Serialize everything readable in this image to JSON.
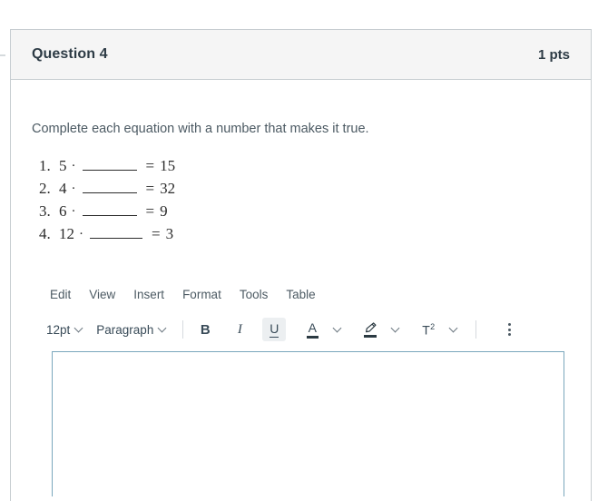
{
  "question": {
    "title": "Question 4",
    "points": "1 pts",
    "prompt": "Complete each equation with a number that makes it true.",
    "equations": [
      {
        "index": "1.",
        "left": "5",
        "operator": "·",
        "blank": "______",
        "equals": "=",
        "right": "15"
      },
      {
        "index": "2.",
        "left": "4",
        "operator": "·",
        "blank": "______",
        "equals": "=",
        "right": "32"
      },
      {
        "index": "3.",
        "left": "6",
        "operator": "·",
        "blank": "______",
        "equals": "=",
        "right": "9"
      },
      {
        "index": "4.",
        "left": "12",
        "operator": "·",
        "blank": "______",
        "equals": "=",
        "right": "3"
      }
    ]
  },
  "editor": {
    "menu": [
      {
        "label": "Edit"
      },
      {
        "label": "View"
      },
      {
        "label": "Insert"
      },
      {
        "label": "Format"
      },
      {
        "label": "Tools"
      },
      {
        "label": "Table"
      }
    ],
    "toolbar": {
      "font_size": "12pt",
      "block_format": "Paragraph",
      "bold": "B",
      "italic": "I",
      "underline": "U",
      "text_color_letter": "A",
      "superscript": "T",
      "superscript_exponent": "2"
    },
    "body_text": ""
  },
  "colors": {
    "header_background": "#f5f5f5",
    "card_border": "#c7cdd1",
    "text": "#2d3b45",
    "muted_text": "#4c5a63",
    "editor_focus_border": "#7aa7bd",
    "active_button_background": "#eceff1"
  }
}
